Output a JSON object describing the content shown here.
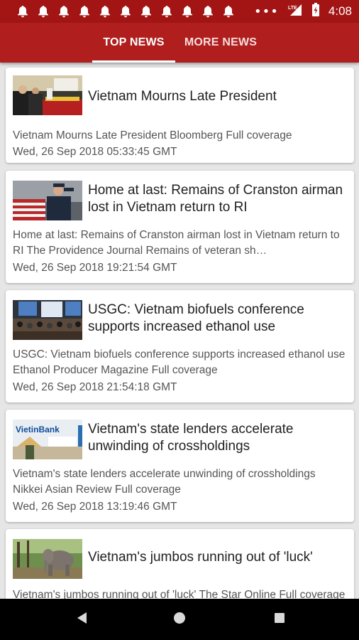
{
  "status_bar": {
    "time": "4:08",
    "overflow": "•••",
    "notification_count": 11,
    "icons": [
      "bell-icon",
      "signal-lte-icon",
      "battery-icon"
    ]
  },
  "tabs": [
    {
      "label": "TOP NEWS",
      "selected": true
    },
    {
      "label": "MORE NEWS",
      "selected": false
    }
  ],
  "colors": {
    "status_bar": "#a31515",
    "tab_bar": "#b01e1e",
    "background": "#e6e6e6"
  },
  "articles": [
    {
      "title": "Vietnam Mourns Late President",
      "summary": "Vietnam Mourns Late President  Bloomberg  Full coverage",
      "date": "Wed, 26 Sep 2018 05:33:45 GMT",
      "thumbnail": "funeral-photo"
    },
    {
      "title": "Home at last: Remains of Cranston airman lost in Vietnam return to RI",
      "summary": "Home at last: Remains of Cranston airman lost in Vietnam return to RI  The Providence Journal  Remains of veteran sh…",
      "date": "Wed, 26 Sep 2018 19:21:54 GMT",
      "thumbnail": "flag-salute-photo"
    },
    {
      "title": "USGC: Vietnam biofuels conference supports increased ethanol use",
      "summary": "USGC: Vietnam biofuels conference supports increased ethanol use  Ethanol Producer Magazine  Full coverage",
      "date": "Wed, 26 Sep 2018 21:54:18 GMT",
      "thumbnail": "conference-photo"
    },
    {
      "title": "Vietnam's state lenders accelerate unwinding of crossholdings",
      "summary": "Vietnam's state lenders accelerate unwinding of crossholdings  Nikkei Asian Review  Full coverage",
      "date": "Wed, 26 Sep 2018 13:19:46 GMT",
      "thumbnail": "vietinbank-photo",
      "thumbnail_text": "VietinBank"
    },
    {
      "title": "Vietnam's jumbos running out of 'luck'",
      "summary": "Vietnam's jumbos running out of 'luck'  The Star Online  Full coverage",
      "date": "",
      "thumbnail": "elephant-photo"
    }
  ],
  "nav_bar": {
    "buttons": [
      "back-icon",
      "home-icon",
      "recents-icon"
    ]
  }
}
